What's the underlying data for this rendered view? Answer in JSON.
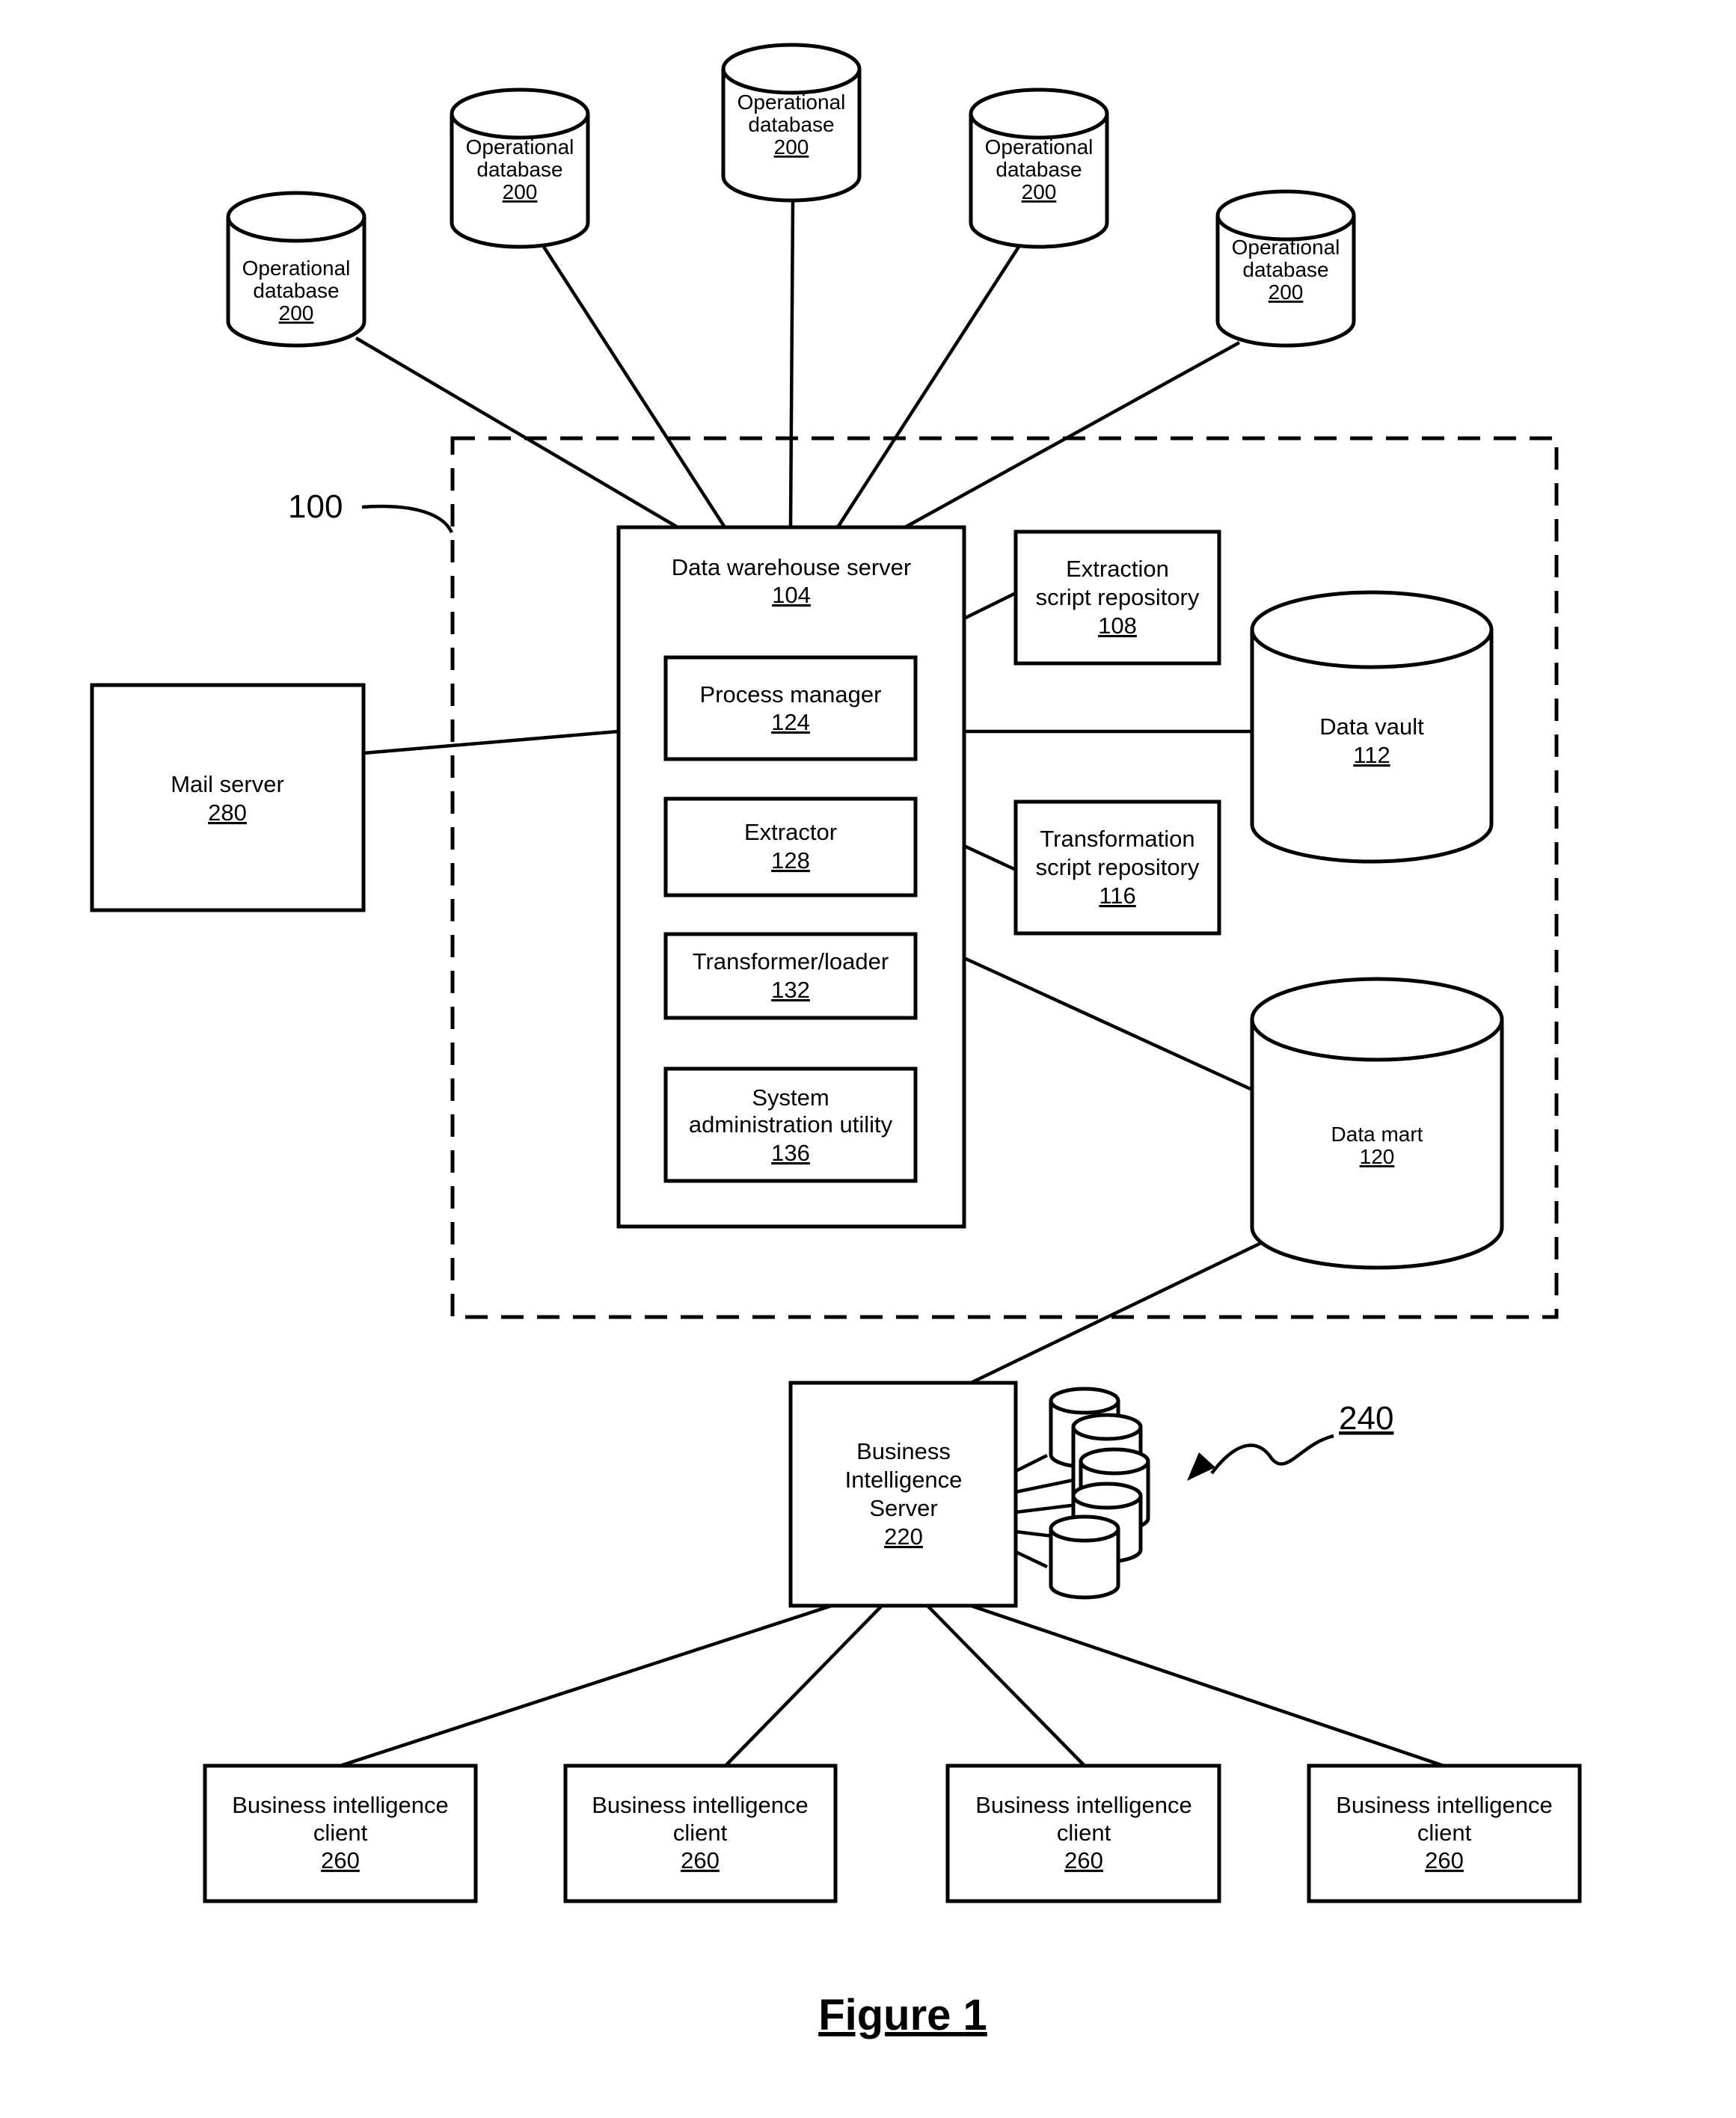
{
  "figure": {
    "caption": "Figure 1",
    "system_ref": "100",
    "db_cluster_ref": "240"
  },
  "operational_databases": [
    {
      "line1": "Operational",
      "line2": "database",
      "ref": "200"
    },
    {
      "line1": "Operational",
      "line2": "database",
      "ref": "200"
    },
    {
      "line1": "Operational",
      "line2": "database",
      "ref": "200"
    },
    {
      "line1": "Operational",
      "line2": "database",
      "ref": "200"
    },
    {
      "line1": "Operational",
      "line2": "database",
      "ref": "200"
    }
  ],
  "data_warehouse_server": {
    "label": "Data warehouse server",
    "ref": "104"
  },
  "components": {
    "process_manager": {
      "label": "Process manager",
      "ref": "124"
    },
    "extractor": {
      "label": "Extractor",
      "ref": "128"
    },
    "transformer_loader": {
      "label": "Transformer/loader",
      "ref": "132"
    },
    "sys_admin": {
      "line1": "System",
      "line2": "administration utility",
      "ref": "136"
    }
  },
  "extraction_repo": {
    "line1": "Extraction",
    "line2": "script repository",
    "ref": "108"
  },
  "transformation_repo": {
    "line1": "Transformation",
    "line2": "script repository",
    "ref": "116"
  },
  "data_vault": {
    "label": "Data vault",
    "ref": "112"
  },
  "data_mart": {
    "label": "Data mart",
    "ref": "120"
  },
  "mail_server": {
    "label": "Mail server",
    "ref": "280"
  },
  "bi_server": {
    "line1": "Business",
    "line2": "Intelligence",
    "line3": "Server",
    "ref": "220"
  },
  "bi_clients": [
    {
      "line1": "Business intelligence",
      "line2": "client",
      "ref": "260"
    },
    {
      "line1": "Business intelligence",
      "line2": "client",
      "ref": "260"
    },
    {
      "line1": "Business intelligence",
      "line2": "client",
      "ref": "260"
    },
    {
      "line1": "Business intelligence",
      "line2": "client",
      "ref": "260"
    }
  ]
}
